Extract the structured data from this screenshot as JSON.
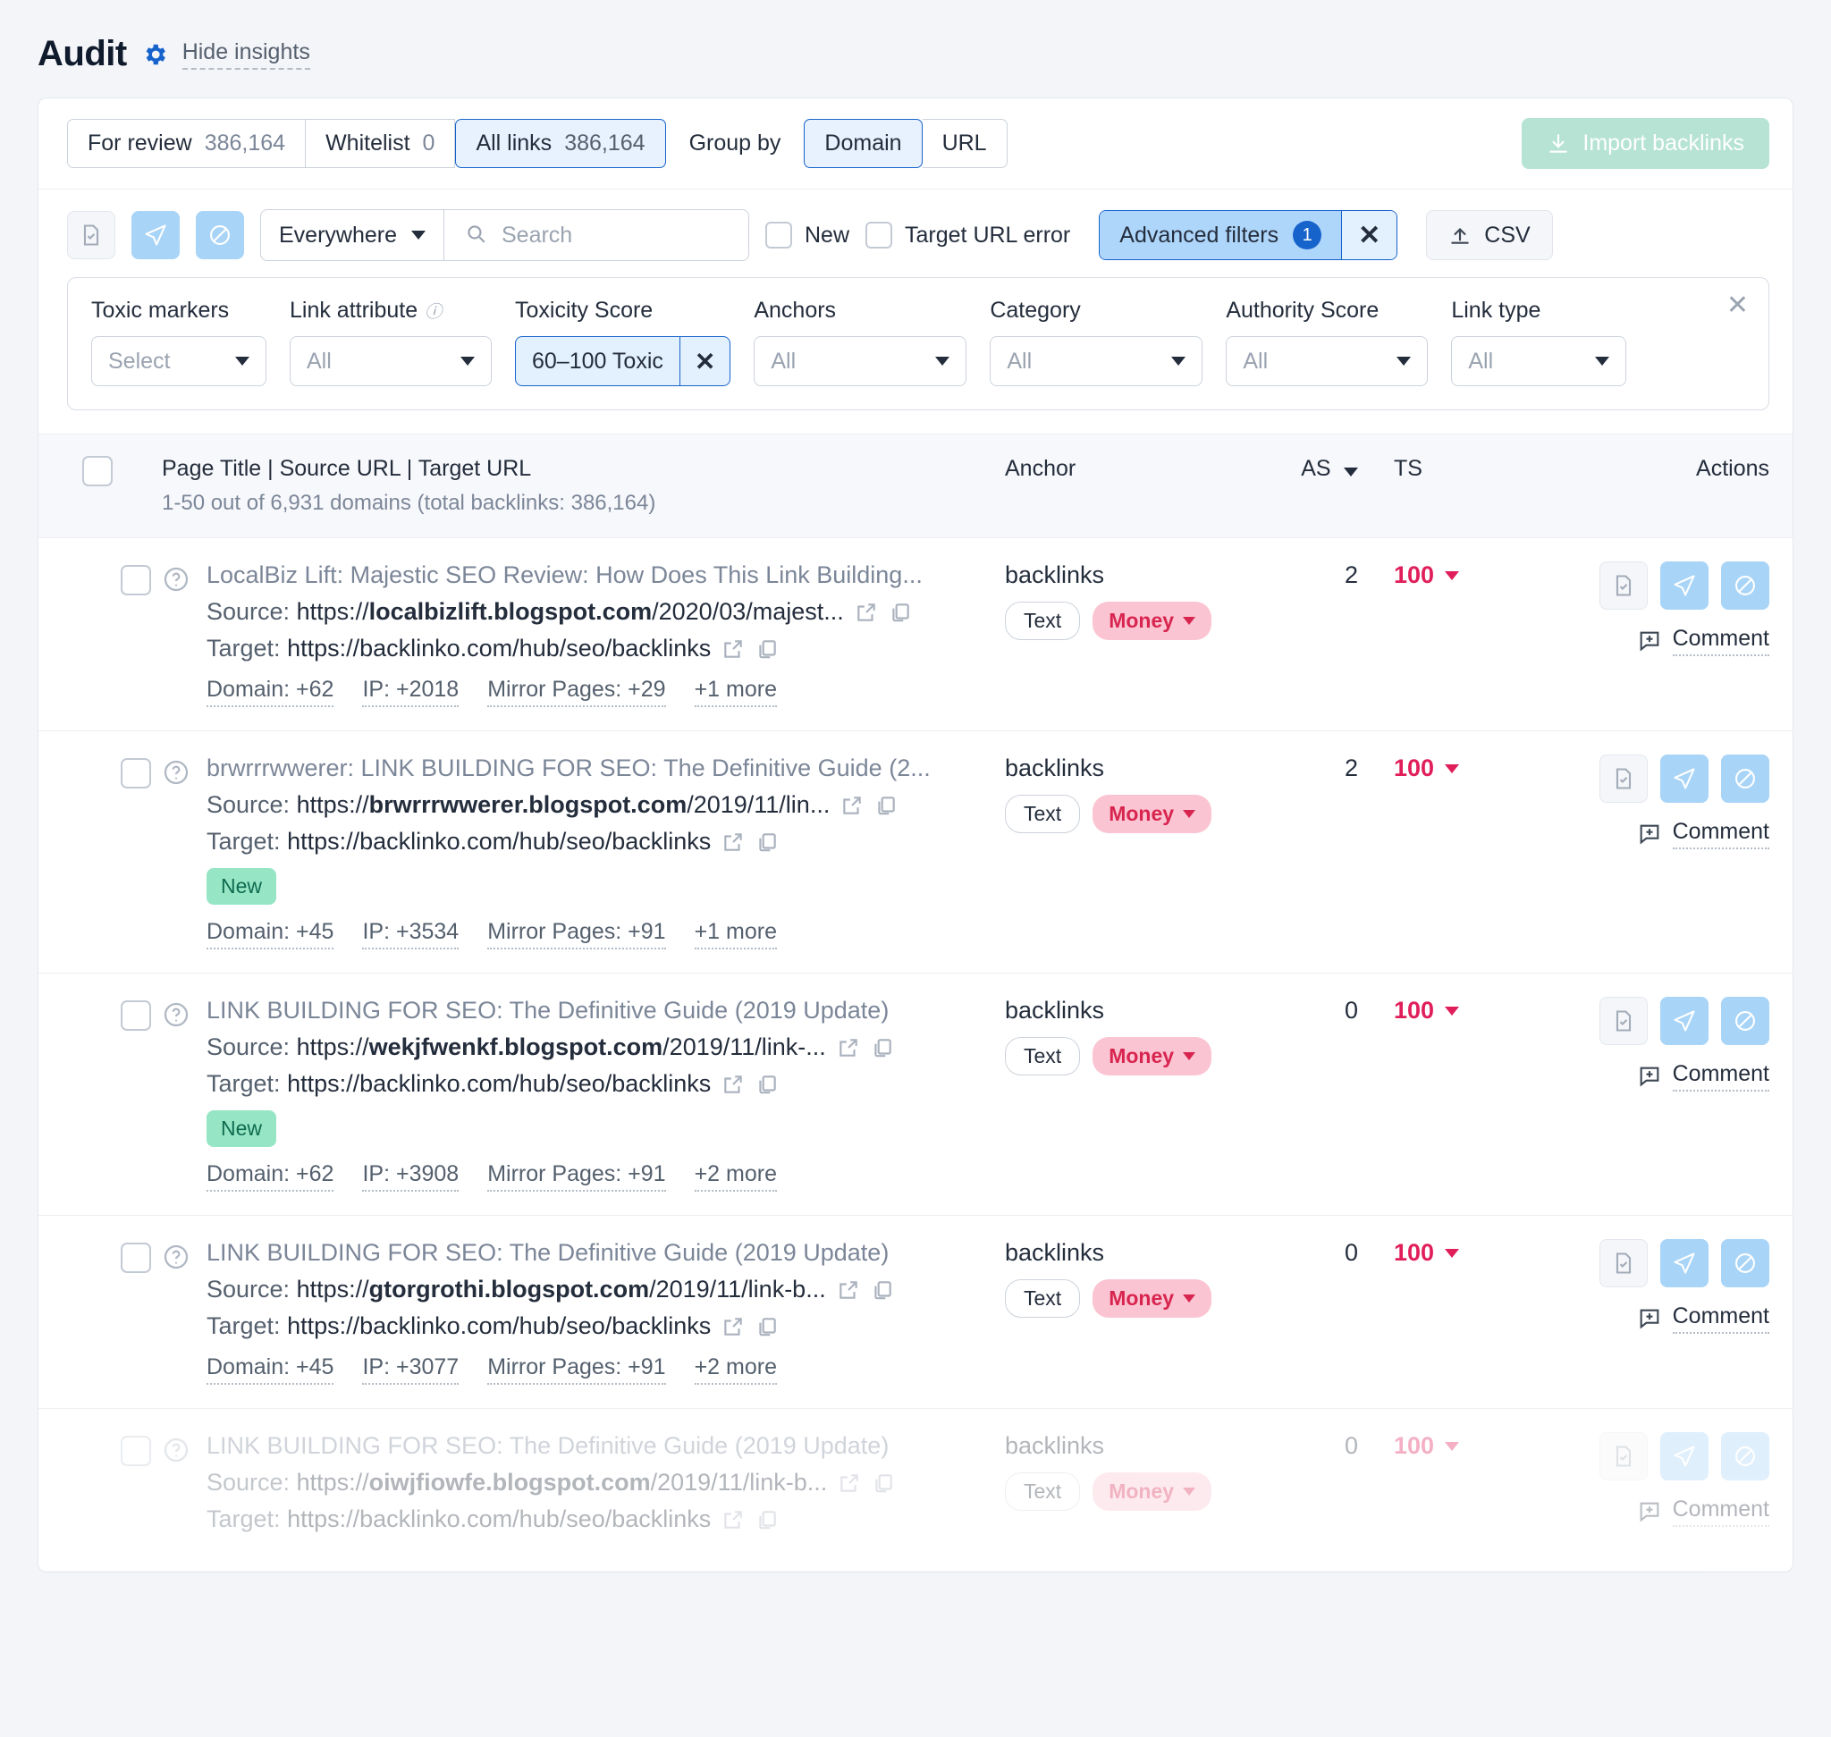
{
  "header": {
    "title": "Audit",
    "gear_icon": "gear-icon",
    "hide_insights": "Hide insights"
  },
  "toolbar": {
    "tabs": [
      {
        "label": "For review",
        "count": "386,164",
        "active": false
      },
      {
        "label": "Whitelist",
        "count": "0",
        "active": false
      },
      {
        "label": "All links",
        "count": "386,164",
        "active": true
      }
    ],
    "group_by_label": "Group by",
    "group_by_options": [
      {
        "label": "Domain",
        "active": true
      },
      {
        "label": "URL",
        "active": false
      }
    ],
    "import_label": "Import backlinks",
    "import_icon": "download-icon",
    "import_color": "#b6e3d4"
  },
  "filterbar": {
    "icon_buttons": [
      {
        "name": "whitelist-icon",
        "style": "plain"
      },
      {
        "name": "send-icon",
        "style": "blue"
      },
      {
        "name": "disavow-icon",
        "style": "blue"
      }
    ],
    "scope": "Everywhere",
    "search_placeholder": "Search",
    "search_value": "",
    "checkboxes": [
      {
        "label": "New",
        "checked": false
      },
      {
        "label": "Target URL error",
        "checked": false
      }
    ],
    "advanced_filters_label": "Advanced filters",
    "advanced_filters_count": "1",
    "clear_label": "✕",
    "csv_label": "CSV",
    "accent": "#1763cc"
  },
  "advanced_panel": {
    "close_label": "✕",
    "filters": [
      {
        "label": "Toxic markers",
        "value": "Select",
        "type": "select",
        "info": false
      },
      {
        "label": "Link attribute",
        "value": "All",
        "type": "select",
        "info": true
      },
      {
        "label": "Toxicity Score",
        "value": "60–100 Toxic",
        "type": "chip",
        "info": false
      },
      {
        "label": "Anchors",
        "value": "All",
        "type": "select",
        "info": false
      },
      {
        "label": "Category",
        "value": "All",
        "type": "select",
        "info": false
      },
      {
        "label": "Authority Score",
        "value": "All",
        "type": "select",
        "info": false
      },
      {
        "label": "Link type",
        "value": "All",
        "type": "select",
        "info": false
      }
    ]
  },
  "table": {
    "header": {
      "main": "Page Title | Source URL | Target URL",
      "subtitle": "1-50 out of 6,931 domains (total backlinks: 386,164)",
      "anchor": "Anchor",
      "as": "AS",
      "ts": "TS",
      "actions": "Actions"
    },
    "rows": [
      {
        "title": "LocalBiz Lift: Majestic SEO Review: How Does This Link Building...",
        "source_label": "Source:",
        "source_prefix": "https://",
        "source_domain": "localbizlift.blogspot.com",
        "source_path": "/2020/03/majest...",
        "target_label": "Target:",
        "target_url": "https://backlinko.com/hub/seo/backlinks",
        "new_badge": "",
        "chips": [
          "Domain: +62",
          "IP: +2018",
          "Mirror Pages: +29",
          "+1 more"
        ],
        "anchor": "backlinks",
        "tag_text": "Text",
        "tag_money": "Money",
        "as": "2",
        "ts": "100",
        "comment": "Comment",
        "faded": false
      },
      {
        "title": "brwrrrwwerer: LINK BUILDING FOR SEO: The Definitive Guide (2...",
        "source_label": "Source:",
        "source_prefix": "https://",
        "source_domain": "brwrrrwwerer.blogspot.com",
        "source_path": "/2019/11/lin...",
        "target_label": "Target:",
        "target_url": "https://backlinko.com/hub/seo/backlinks",
        "new_badge": "New",
        "chips": [
          "Domain: +45",
          "IP: +3534",
          "Mirror Pages: +91",
          "+1 more"
        ],
        "anchor": "backlinks",
        "tag_text": "Text",
        "tag_money": "Money",
        "as": "2",
        "ts": "100",
        "comment": "Comment",
        "faded": false
      },
      {
        "title": "LINK BUILDING FOR SEO: The Definitive Guide (2019 Update)",
        "source_label": "Source:",
        "source_prefix": "https://",
        "source_domain": "wekjfwenkf.blogspot.com",
        "source_path": "/2019/11/link-...",
        "target_label": "Target:",
        "target_url": "https://backlinko.com/hub/seo/backlinks",
        "new_badge": "New",
        "chips": [
          "Domain: +62",
          "IP: +3908",
          "Mirror Pages: +91",
          "+2 more"
        ],
        "anchor": "backlinks",
        "tag_text": "Text",
        "tag_money": "Money",
        "as": "0",
        "ts": "100",
        "comment": "Comment",
        "faded": false
      },
      {
        "title": "LINK BUILDING FOR SEO: The Definitive Guide (2019 Update)",
        "source_label": "Source:",
        "source_prefix": "https://",
        "source_domain": "gtorgrothi.blogspot.com",
        "source_path": "/2019/11/link-b...",
        "target_label": "Target:",
        "target_url": "https://backlinko.com/hub/seo/backlinks",
        "new_badge": "",
        "chips": [
          "Domain: +45",
          "IP: +3077",
          "Mirror Pages: +91",
          "+2 more"
        ],
        "anchor": "backlinks",
        "tag_text": "Text",
        "tag_money": "Money",
        "as": "0",
        "ts": "100",
        "comment": "Comment",
        "faded": false
      },
      {
        "title": "LINK BUILDING FOR SEO: The Definitive Guide (2019 Update)",
        "source_label": "Source:",
        "source_prefix": "https://",
        "source_domain": "oiwjfiowfe.blogspot.com",
        "source_path": "/2019/11/link-b...",
        "target_label": "Target:",
        "target_url": "https://backlinko.com/hub/seo/backlinks",
        "new_badge": "",
        "chips": [],
        "anchor": "backlinks",
        "tag_text": "Text",
        "tag_money": "Money",
        "as": "0",
        "ts": "100",
        "comment": "Comment",
        "faded": true
      }
    ]
  }
}
